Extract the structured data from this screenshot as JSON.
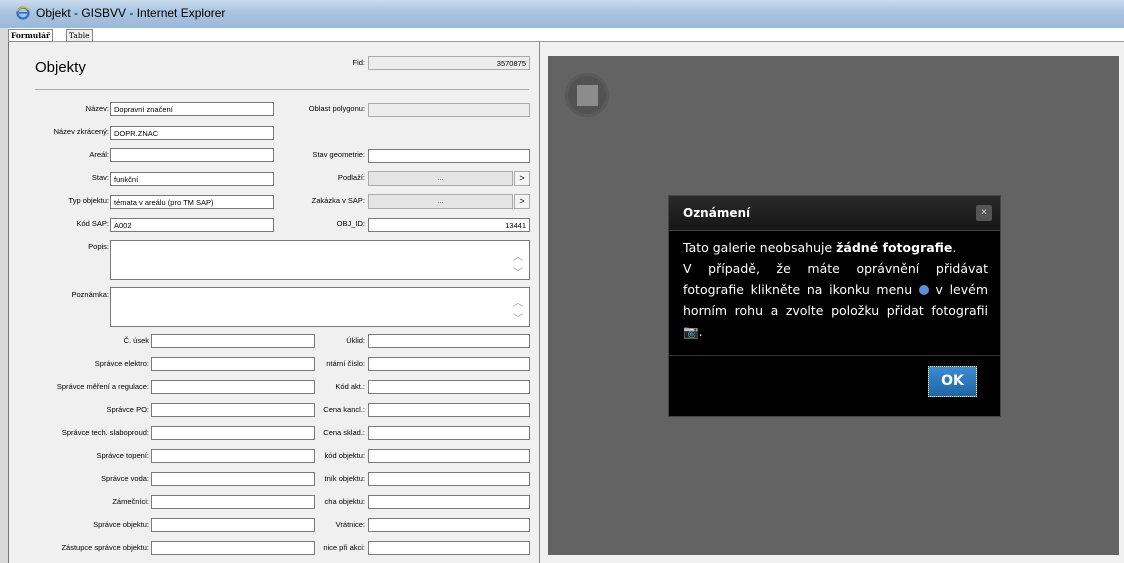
{
  "window": {
    "title": "Objekt - GISBVV - Internet Explorer",
    "icon": "ie-icon"
  },
  "tabs": [
    {
      "label": "Formulář"
    },
    {
      "label": "Table"
    }
  ],
  "form": {
    "title": "Objekty",
    "fid_label": "Fid:",
    "fid_value": "3570875",
    "rows_top": [
      {
        "label": "Název:",
        "value": "Dopravní značení"
      },
      {
        "label": "Název zkrácený:",
        "value": "DOPR.ZNAC"
      },
      {
        "label": "Areál:",
        "value": ""
      },
      {
        "label": "Stav:",
        "value": "funkční"
      },
      {
        "label": "Typ objektu:",
        "value": "témata v areálu (pro TM SAP)"
      },
      {
        "label": "Kód SAP:",
        "value": "A002"
      }
    ],
    "rows_right": [
      {
        "label": "Oblast polygonu:",
        "value": ""
      },
      {
        "label": "Stav geometrie:",
        "value": ""
      },
      {
        "label": "Podlaží:",
        "value": "...",
        "btn": ">"
      },
      {
        "label": "Zakázka v SAP:",
        "value": "...",
        "btn": ">"
      },
      {
        "label": "OBJ_ID:",
        "value": "13441"
      }
    ],
    "popis_label": "Popis:",
    "popis_value": "",
    "poznamka_label": "Poznámka:",
    "poznamka_value": "",
    "rows_bottom_left": [
      {
        "label": "Č. úsek",
        "value": ""
      },
      {
        "label": "Správce elektro:",
        "value": ""
      },
      {
        "label": "Správce měření a regulace:",
        "value": ""
      },
      {
        "label": "Správce PO:",
        "value": ""
      },
      {
        "label": "Správce tech. slaboproud:",
        "value": ""
      },
      {
        "label": "Správce topení:",
        "value": ""
      },
      {
        "label": "Správce voda:",
        "value": ""
      },
      {
        "label": "Zámečníci:",
        "value": ""
      },
      {
        "label": "Správce objektu:",
        "value": ""
      },
      {
        "label": "Zástupce správce objektu:",
        "value": ""
      }
    ],
    "rows_bottom_right": [
      {
        "label": "Úklid:",
        "value": ""
      },
      {
        "label": "ntární číslo:",
        "value": ""
      },
      {
        "label": "Kód akt.:",
        "value": ""
      },
      {
        "label": "Cena kancl.:",
        "value": ""
      },
      {
        "label": "Cena sklad.:",
        "value": ""
      },
      {
        "label": "kód objektu:",
        "value": ""
      },
      {
        "label": "tník objektu:",
        "value": ""
      },
      {
        "label": "cha objektu:",
        "value": ""
      },
      {
        "label": "Vrátnice:",
        "value": ""
      },
      {
        "label": "nice při akci:",
        "value": ""
      }
    ]
  },
  "gallery": {
    "menu_icon": "grid-menu-icon",
    "dialog": {
      "title": "Oznámení",
      "text_1": "Tato galerie neobsahuje ",
      "text_bold": "žádné fotografie",
      "text_2": ".",
      "text_3": "V případě, že máte oprávnění přidávat fotografie klikněte na ikonku menu ",
      "text_4": " v levém horním rohu a zvolte položku přidat fotografii ",
      "text_5": ".",
      "ok_label": "OK",
      "close_label": "×"
    }
  },
  "colors": {
    "gallery_bg": "#636363",
    "dialog_bg": "#000000",
    "ok_button": "#2a78c0"
  }
}
